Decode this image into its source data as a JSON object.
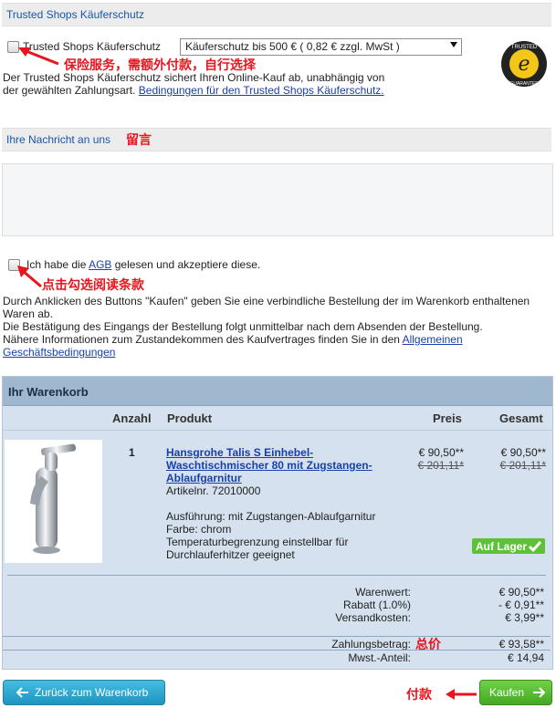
{
  "trusted_shops": {
    "section_title": "Trusted Shops Käuferschutz",
    "checkbox_label": "Trusted Shops Käuferschutz",
    "select_value": "Käuferschutz bis 500 € ( 0,82 € zzgl. MwSt )",
    "annotation": "保险服务，需额外付款，自行选择",
    "desc_line1": "Der Trusted Shops Käuferschutz sichert Ihren Online-Kauf ab, unabhängig von",
    "desc_line2_prefix": "der gewählten Zahlungsart.",
    "desc_link": "Bedingungen für den Trusted Shops Käuferschutz.",
    "seal_text_top": "TRUSTED",
    "seal_text_bottom": "GUARANTEE",
    "seal_letter": "e"
  },
  "message": {
    "section_title": "Ihre Nachricht an uns",
    "annotation": "留言"
  },
  "agb": {
    "label_prefix": "Ich habe die",
    "label_link": "AGB",
    "label_suffix": "gelesen und akzeptiere diese.",
    "annotation": "点击勾选阅读条款",
    "notice_line1": "Durch Anklicken des Buttons \"Kaufen\" geben Sie eine verbindliche Bestellung der im Warenkorb enthaltenen",
    "notice_line2": "Waren ab.",
    "notice_line3": "Die Bestätigung des Eingangs der Bestellung folgt unmittelbar nach dem Absenden der Bestellung.",
    "notice_line4_prefix": "Nähere Informationen zum Zustandekommen des Kaufvertrages finden Sie in den",
    "notice_link_part1": "Allgemeinen",
    "notice_link_part2": "Geschäftsbedingungen"
  },
  "cart": {
    "title": "Ihr Warenkorb",
    "columns": {
      "qty": "Anzahl",
      "product": "Produkt",
      "price": "Preis",
      "total": "Gesamt"
    },
    "item": {
      "qty": "1",
      "name_line1": "Hansgrohe Talis S Einhebel-",
      "name_line2": "Waschtischmischer 80 mit Zugstangen-",
      "name_line3": "Ablaufgarnitur",
      "article": "Artikelnr. 72010000",
      "detail1": "Ausführung: mit Zugstangen-Ablaufgarnitur",
      "detail2": "Farbe: chrom",
      "detail3": "Temperaturbegrenzung einstellbar für",
      "detail4": "Durchlauferhitzer geeignet",
      "price": "€ 90,50**",
      "price_old": "€ 201,11*",
      "total": "€ 90,50**",
      "total_old": "€ 201,11*",
      "stock": "Auf Lager"
    },
    "summary": {
      "goods_label": "Warenwert:",
      "goods_value": "€ 90,50**",
      "discount_label": "Rabatt (1.0%)",
      "discount_value": "- € 0,91**",
      "shipping_label": "Versandkosten:",
      "shipping_value": "€ 3,99**",
      "payment_label": "Zahlungsbetrag:",
      "payment_value": "€ 93,58**",
      "payment_annotation": "总价",
      "vat_label": "Mwst.-Anteil:",
      "vat_value": "€ 14,94"
    }
  },
  "buttons": {
    "back": "Zurück zum Warenkorb",
    "buy": "Kaufen",
    "buy_annotation": "付款"
  },
  "colors": {
    "link": "#1a40a8",
    "annotation_red": "#e8141e",
    "cart_bg": "#d5e1ee",
    "stock_green": "#5ec13a"
  }
}
